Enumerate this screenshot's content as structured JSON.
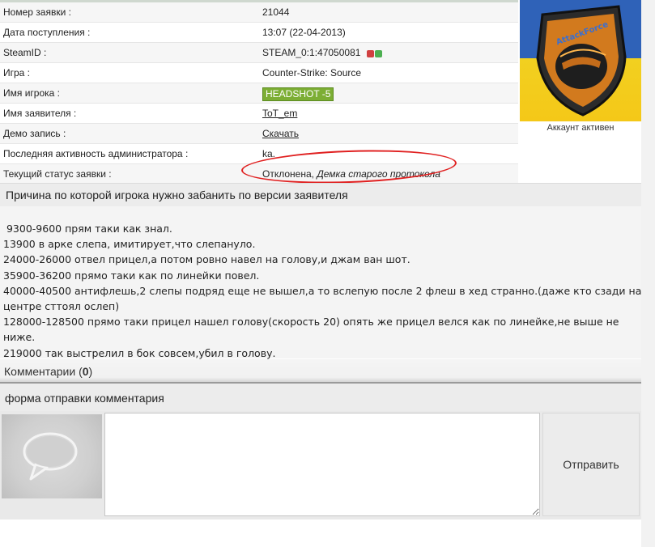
{
  "ticket": {
    "rows": [
      {
        "label": "Номер заявки :",
        "value": "21044"
      },
      {
        "label": "Дата поступления :",
        "value": "13:07 (22-04-2013)"
      },
      {
        "label": "SteamID :",
        "value": "STEAM_0:1:47050081"
      },
      {
        "label": "Игра :",
        "value": "Counter-Strike: Source"
      },
      {
        "label": "Имя игрока :",
        "value": "HEADSHOT -5"
      },
      {
        "label": "Имя заявителя :",
        "value": "ToT_em"
      },
      {
        "label": "Демо запись :",
        "value": "Скачать"
      },
      {
        "label": "Последняя активность администратора :",
        "value": "ka."
      },
      {
        "label": "Текущий статус заявки :",
        "status": "Отклонена,",
        "status_note": "Демка старого протокола"
      }
    ]
  },
  "avatar": {
    "logo_text": "AttackForce",
    "caption": "Аккаунт активен"
  },
  "reason": {
    "title": "Причина по которой игрока нужно забанить по версии заявителя",
    "lines": [
      " 9300-9600 прям таки как знал.",
      "13900 в арке слепа, имитирует,что слепануло.",
      "24000-26000 отвел прицел,а потом ровно навел на голову,и джам ван шот.",
      "35900-36200 прямо таки как по линейки повел.",
      "40000-40500 антифлешь,2 слепы подряд еще не вышел,а то вслепую после 2 флеш в хед странно.(даже кто сзади на центре сттоял ослеп)",
      "128000-128500 прямо таки прицел нашел голову(скорость 20) опять же прицел велся как по линейке,не выше не ниже.",
      "219000 так выстрелил в бок совсем,убил в голову."
    ]
  },
  "comments": {
    "label": "Комментарии (",
    "count": "0",
    "close": ")"
  },
  "comment_form": {
    "title": "форма отправки комментария",
    "textarea_value": "",
    "submit_label": "Отправить"
  },
  "colors": {
    "badge_green": "#7cae34",
    "annotation_red": "#e02020",
    "flag_blue": "#2f62b8",
    "flag_yellow": "#f2d020"
  }
}
